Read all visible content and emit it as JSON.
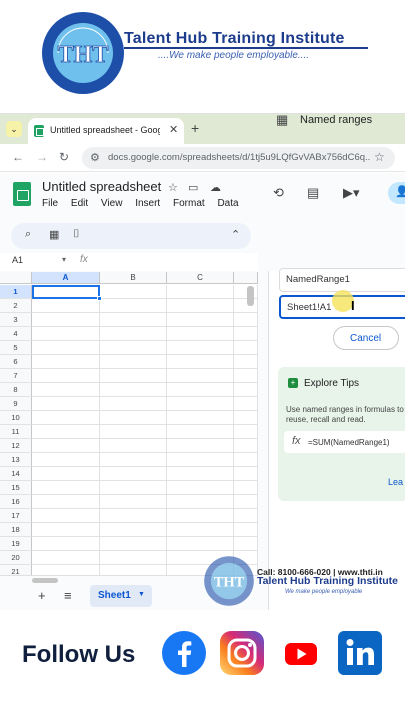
{
  "banner": {
    "brand_name": "Talent Hub Training Institute",
    "tagline": "....We make people employable....",
    "logo_letters": "THT",
    "logo_arc_text": "Talent Hub Training"
  },
  "browser": {
    "tab_title": "Untitled spreadsheet - Google",
    "url": "docs.google.com/spreadsheets/d/1tj5u9LQfGvVABx756dC6q..."
  },
  "sheets": {
    "doc_title": "Untitled spreadsheet",
    "menus": [
      "File",
      "Edit",
      "View",
      "Insert",
      "Format",
      "Data"
    ],
    "name_box": "A1",
    "formula_icon": "fx",
    "columns": [
      "A",
      "B",
      "C"
    ],
    "rows": [
      "1",
      "2",
      "3",
      "4",
      "5",
      "6",
      "7",
      "8",
      "9",
      "10",
      "11",
      "12",
      "13",
      "14",
      "15",
      "16",
      "17",
      "18",
      "19",
      "20",
      "21"
    ],
    "sheet_tab": "Sheet1"
  },
  "panel": {
    "title": "Named ranges",
    "range_name_value": "NamedRange1",
    "range_value": "Sheet1!A1",
    "cancel_label": "Cancel",
    "tips_title": "Explore Tips",
    "tips_body": "Use named ranges in formulas to reuse, recall and read.",
    "tips_formula": "=SUM(NamedRange1)",
    "tips_link": "Lea"
  },
  "watermark": {
    "contact": "Call: 8100-666-020 | www.thti.in",
    "name": "Talent Hub Training Institute",
    "tagline": "We make people employable"
  },
  "footer": {
    "follow_label": "Follow Us"
  },
  "icons": {
    "social": [
      "facebook-icon",
      "instagram-icon",
      "youtube-icon",
      "linkedin-icon"
    ]
  },
  "colors": {
    "brand_blue": "#1e3c8c",
    "sheets_green": "#1fa463",
    "selection_blue": "#1a73e8",
    "facebook": "#1877f2",
    "youtube": "#ff0000",
    "linkedin": "#0a66c2"
  }
}
